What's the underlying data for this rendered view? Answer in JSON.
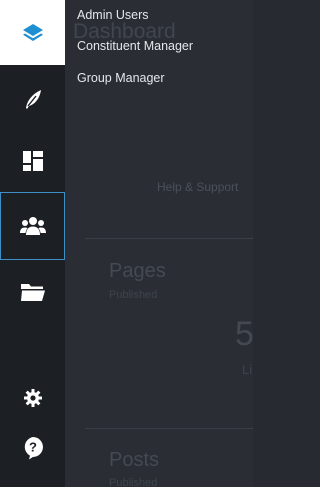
{
  "background": {
    "title": "Dashboard",
    "help": "Help & Support",
    "pages_card": {
      "title": "Pages",
      "subtitle": "Published",
      "value": "5",
      "value_label": "Li"
    },
    "posts_card": {
      "title": "Posts",
      "subtitle": "Published"
    }
  },
  "flyout": {
    "items": [
      {
        "label": "Admin Users"
      },
      {
        "label": "Constituent Manager"
      },
      {
        "label": "Group Manager"
      }
    ]
  },
  "sidebar": {
    "items": [
      {
        "icon": "layers-icon"
      },
      {
        "icon": "feather-icon"
      },
      {
        "icon": "dashboard-icon"
      },
      {
        "icon": "users-icon",
        "active": true
      },
      {
        "icon": "folder-icon"
      },
      {
        "icon": "gear-icon"
      },
      {
        "icon": "help-icon"
      }
    ]
  },
  "colors": {
    "accent": "#3d8fc6",
    "sidebar": "#1c1f24",
    "logo": "#1f8fd1"
  }
}
